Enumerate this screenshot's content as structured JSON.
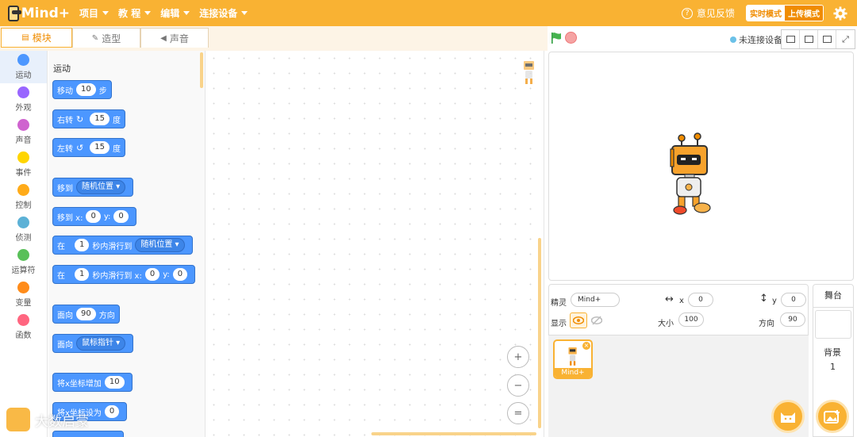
{
  "app": {
    "logo_text": "Mind+"
  },
  "menu": [
    {
      "label": "项目"
    },
    {
      "label": "教 程"
    },
    {
      "label": "编辑"
    },
    {
      "label": "连接设备"
    }
  ],
  "topright": {
    "feedback": "意见反馈",
    "mode_live": "实时模式",
    "mode_upload": "上传模式",
    "help_glyph": "?"
  },
  "tabs": [
    {
      "label": "模块",
      "icon": "blocks-icon"
    },
    {
      "label": "造型",
      "icon": "brush-icon"
    },
    {
      "label": "声音",
      "icon": "speaker-icon"
    }
  ],
  "connection": {
    "status": "未连接设备"
  },
  "categories": [
    {
      "label": "运动",
      "color": "#4c97ff"
    },
    {
      "label": "外观",
      "color": "#9966ff"
    },
    {
      "label": "声音",
      "color": "#cf63cf"
    },
    {
      "label": "事件",
      "color": "#ffd500"
    },
    {
      "label": "控制",
      "color": "#ffab19"
    },
    {
      "label": "侦测",
      "color": "#5cb1d6"
    },
    {
      "label": "运算符",
      "color": "#59c059"
    },
    {
      "label": "变量",
      "color": "#ff8c1a"
    },
    {
      "label": "函数",
      "color": "#ff6680"
    }
  ],
  "palette": {
    "section": "运动",
    "blocks": {
      "move": {
        "pre": "移动",
        "val": "10",
        "post": "步"
      },
      "turn_right": {
        "pre": "右转",
        "icon": "↻",
        "val": "15",
        "post": "度"
      },
      "turn_left": {
        "pre": "左转",
        "icon": "↺",
        "val": "15",
        "post": "度"
      },
      "goto": {
        "pre": "移到",
        "drop": "随机位置"
      },
      "goto_xy": {
        "pre": "移到 x:",
        "x": "0",
        "mid": "y:",
        "y": "0"
      },
      "glide": {
        "pre": "在",
        "val": "1",
        "mid": "秒内滑行到",
        "drop": "随机位置"
      },
      "glide_xy": {
        "pre": "在",
        "val": "1",
        "mid": "秒内滑行到 x:",
        "x": "0",
        "mid2": "y:",
        "y": "0"
      },
      "point_dir": {
        "pre": "面向",
        "val": "90",
        "post": "方向"
      },
      "point_towards": {
        "pre": "面向",
        "drop": "鼠标指针"
      },
      "change_x": {
        "pre": "将x坐标增加",
        "val": "10"
      },
      "set_x": {
        "pre": "将x坐标设为",
        "val": "0"
      }
    }
  },
  "zoom": {
    "in": "+",
    "out": "−",
    "reset": "="
  },
  "sprite_info": {
    "sprite_label": "精灵",
    "sprite_name": "Mind+",
    "x_label": "x",
    "x": "0",
    "y_label": "y",
    "y": "0",
    "show_label": "显示",
    "size_label": "大小",
    "size": "100",
    "dir_label": "方向",
    "direction": "90"
  },
  "sprites": [
    {
      "name": "Mind+"
    }
  ],
  "stage_panel": {
    "title": "舞台",
    "backdrop_label": "背景",
    "backdrop_count": "1"
  },
  "watermark": "大数启蒙",
  "colors": {
    "accent": "#f9b233",
    "motion": "#4c97ff"
  }
}
